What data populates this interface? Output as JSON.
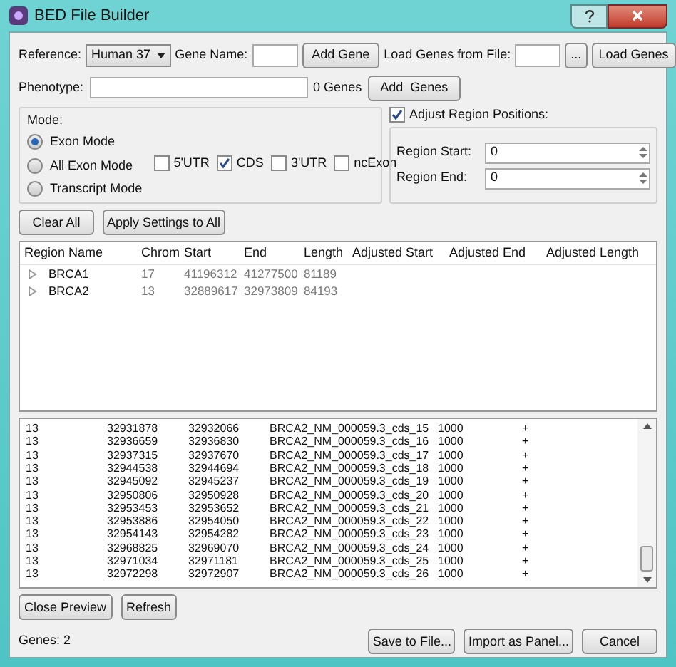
{
  "window": {
    "title": "BED File Builder"
  },
  "reference": {
    "label": "Reference:",
    "value": "Human 37"
  },
  "gene_name": {
    "label": "Gene Name:",
    "button": "Add Gene"
  },
  "load_file": {
    "label": "Load Genes from File:",
    "browse": "...",
    "button": "Load Genes"
  },
  "phenotype": {
    "label": "Phenotype:",
    "count": "0 Genes",
    "button": "Add  Genes"
  },
  "mode": {
    "title": "Mode:",
    "options": [
      {
        "label": "Exon Mode",
        "selected": true
      },
      {
        "label": "All Exon Mode",
        "selected": false
      },
      {
        "label": "Transcript Mode",
        "selected": false
      }
    ],
    "features": [
      {
        "label": "5'UTR",
        "checked": false
      },
      {
        "label": "CDS",
        "checked": true
      },
      {
        "label": "3'UTR",
        "checked": false
      },
      {
        "label": "ncExon",
        "checked": false
      }
    ]
  },
  "adjust": {
    "label": "Adjust Region Positions:",
    "checked": true,
    "fields": [
      {
        "label": "Region Start:",
        "value": "0"
      },
      {
        "label": "Region End:",
        "value": "0"
      }
    ]
  },
  "actions": [
    "Clear All",
    "Apply Settings to All"
  ],
  "regions": {
    "columns": [
      "Region Name",
      "Chrom",
      "Start",
      "End",
      "Length",
      "Adjusted Start",
      "Adjusted End",
      "Adjusted Length"
    ],
    "rows": [
      {
        "expanded": false,
        "cells": [
          "BRCA1",
          "17",
          "41196312",
          "41277500",
          "81189"
        ]
      },
      {
        "expanded": false,
        "cells": [
          "BRCA2",
          "13",
          "32889617",
          "32973809",
          "84193"
        ]
      }
    ]
  },
  "preview": {
    "rows": [
      [
        "13",
        "32931878",
        "32932066",
        "BRCA2_NM_000059.3_cds_15",
        "1000",
        "+"
      ],
      [
        "13",
        "32936659",
        "32936830",
        "BRCA2_NM_000059.3_cds_16",
        "1000",
        "+"
      ],
      [
        "13",
        "32937315",
        "32937670",
        "BRCA2_NM_000059.3_cds_17",
        "1000",
        "+"
      ],
      [
        "13",
        "32944538",
        "32944694",
        "BRCA2_NM_000059.3_cds_18",
        "1000",
        "+"
      ],
      [
        "13",
        "32945092",
        "32945237",
        "BRCA2_NM_000059.3_cds_19",
        "1000",
        "+"
      ],
      [
        "13",
        "32950806",
        "32950928",
        "BRCA2_NM_000059.3_cds_20",
        "1000",
        "+"
      ],
      [
        "13",
        "32953453",
        "32953652",
        "BRCA2_NM_000059.3_cds_21",
        "1000",
        "+"
      ],
      [
        "13",
        "32953886",
        "32954050",
        "BRCA2_NM_000059.3_cds_22",
        "1000",
        "+"
      ],
      [
        "13",
        "32954143",
        "32954282",
        "BRCA2_NM_000059.3_cds_23",
        "1000",
        "+"
      ],
      [
        "13",
        "32968825",
        "32969070",
        "BRCA2_NM_000059.3_cds_24",
        "1000",
        "+"
      ],
      [
        "13",
        "32971034",
        "32971181",
        "BRCA2_NM_000059.3_cds_25",
        "1000",
        "+"
      ],
      [
        "13",
        "32972298",
        "32972907",
        "BRCA2_NM_000059.3_cds_26",
        "1000",
        "+"
      ]
    ]
  },
  "preview_buttons": [
    "Close Preview",
    "Refresh"
  ],
  "status": "Genes: 2",
  "footer_buttons": [
    "Save to File...",
    "Import as Panel...",
    "Cancel"
  ]
}
